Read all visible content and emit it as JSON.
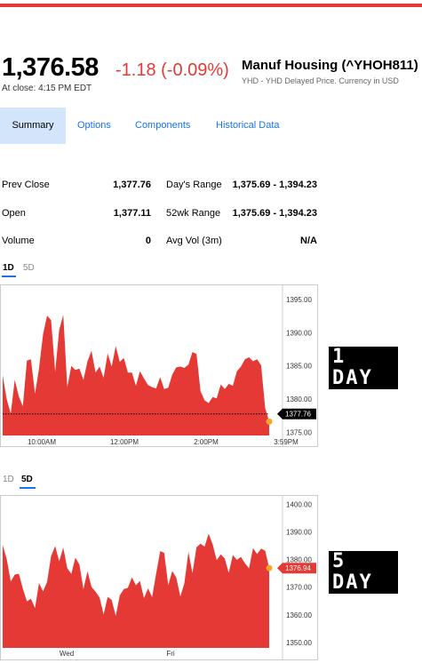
{
  "quote": {
    "price": "1,376.58",
    "change": "-1.18 (-0.09%)",
    "close_note": "At close: 4:15 PM EDT",
    "name": "Manuf Housing (^YHOH811)",
    "subtitle": "YHD - YHD Delayed Price. Currency in USD"
  },
  "tabs": [
    {
      "label": "Summary",
      "active": true
    },
    {
      "label": "Options"
    },
    {
      "label": "Components"
    },
    {
      "label": "Historical Data"
    }
  ],
  "stats": {
    "prev_close_label": "Prev Close",
    "prev_close": "1,377.76",
    "open_label": "Open",
    "open": "1,377.11",
    "volume_label": "Volume",
    "volume": "0",
    "days_range_label": "Day's Range",
    "days_range": "1,375.69 - 1,394.23",
    "wk52_label": "52wk Range",
    "wk52": "1,375.69 - 1,394.23",
    "avg_vol_label": "Avg Vol (3m)",
    "avg_vol": "N/A"
  },
  "chart1_range": {
    "a": "1D",
    "b": "5D",
    "selected": "1D"
  },
  "chart2_range": {
    "a": "1D",
    "b": "5D",
    "selected": "5D"
  },
  "badges": {
    "one_day": "1 DAY",
    "five_day": "5 DAY"
  },
  "colors": {
    "accent": "#e53935",
    "link": "#1a73e8",
    "tab_active_bg": "#d2e5fa",
    "marker": "#f5a623"
  },
  "chart_data": [
    {
      "type": "area",
      "range": "1D",
      "ylim": [
        1374.5,
        1396.5
      ],
      "y_ticks": [
        1395,
        1390,
        1385,
        1380,
        1375
      ],
      "y_tick_labels": [
        "1395.00",
        "1390.00",
        "1385.00",
        "1380.00",
        "1375.00"
      ],
      "x_tick_labels": [
        "10:00AM",
        "12:00PM",
        "2:00PM",
        "3:59PM"
      ],
      "reference_line": {
        "value": 1377.76,
        "label": "1377.76",
        "style": "dotted"
      },
      "values": [
        1383.6,
        1380.0,
        1377.8,
        1382.9,
        1380.4,
        1378.9,
        1385.8,
        1386.0,
        1380.8,
        1384.6,
        1389.8,
        1392.6,
        1391.9,
        1384.1,
        1390.4,
        1392.7,
        1381.8,
        1385.0,
        1384.4,
        1384.6,
        1382.9,
        1385.7,
        1387.3,
        1384.0,
        1384.9,
        1383.2,
        1386.9,
        1384.9,
        1388.0,
        1385.6,
        1386.2,
        1384.0,
        1384.0,
        1382.0,
        1384.2,
        1383.1,
        1382.1,
        1381.8,
        1381.6,
        1383.3,
        1381.5,
        1381.7,
        1383.7,
        1384.8,
        1384.9,
        1384.7,
        1385.2,
        1387.1,
        1386.8,
        1381.2,
        1379.8,
        1379.4,
        1380.3,
        1380.1,
        1382.2,
        1381.5,
        1382.3,
        1382.0,
        1384.2,
        1384.9,
        1386.0,
        1386.3,
        1385.7,
        1386.0,
        1385.1,
        1378.6,
        1376.6
      ],
      "last": 1376.6
    },
    {
      "type": "area",
      "range": "5D",
      "ylim": [
        1348,
        1401.5
      ],
      "y_ticks": [
        1400,
        1390,
        1380,
        1370,
        1360,
        1350
      ],
      "y_tick_labels": [
        "1400.00",
        "1390.00",
        "1380.00",
        "1370.00",
        "1360.00",
        "1350.00"
      ],
      "x_tick_labels": [
        "Wed",
        "Fri"
      ],
      "price_marker": {
        "value": 1376.94,
        "label": "1376.94"
      },
      "values": [
        1385.3,
        1380.3,
        1372.1,
        1374.6,
        1374.9,
        1369.5,
        1364.9,
        1365.8,
        1362.4,
        1371.5,
        1368.5,
        1371.9,
        1381.3,
        1384.9,
        1379.4,
        1384.4,
        1376.9,
        1374.8,
        1380.7,
        1378.2,
        1369.3,
        1375.8,
        1370.1,
        1368.4,
        1366.3,
        1360.1,
        1366.5,
        1365.4,
        1359.6,
        1367.0,
        1369.3,
        1369.8,
        1373.6,
        1370.7,
        1372.3,
        1366.0,
        1369.6,
        1366.4,
        1374.8,
        1383.1,
        1382.5,
        1370.7,
        1375.9,
        1373.4,
        1366.6,
        1371.4,
        1382.8,
        1375.1,
        1384.5,
        1385.8,
        1384.7,
        1389.4,
        1385.5,
        1379.8,
        1381.9,
        1380.4,
        1375.2,
        1381.7,
        1379.9,
        1381.0,
        1378.7,
        1376.8,
        1384.2,
        1382.0,
        1384.0,
        1383.2,
        1376.9
      ],
      "last": 1376.94
    }
  ]
}
